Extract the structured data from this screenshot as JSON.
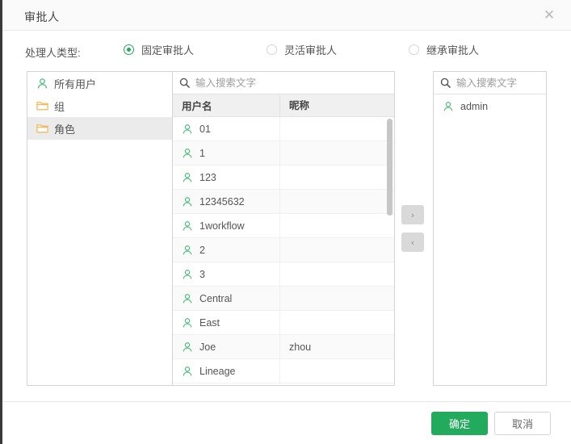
{
  "dialog": {
    "title": "审批人",
    "close_icon": "close-icon"
  },
  "handler_type": {
    "label": "处理人类型:",
    "options": [
      {
        "label": "固定审批人",
        "checked": true
      },
      {
        "label": "灵活审批人",
        "checked": false
      },
      {
        "label": "继承审批人",
        "checked": false
      }
    ]
  },
  "tree_panel": {
    "items": [
      {
        "label": "所有用户",
        "icon": "user-icon",
        "selected": false
      },
      {
        "label": "组",
        "icon": "folder-icon",
        "selected": false
      },
      {
        "label": "角色",
        "icon": "folder-icon",
        "selected": true
      }
    ]
  },
  "source_panel": {
    "search": {
      "placeholder": "输入搜索文字",
      "value": "",
      "icon": "search-icon"
    },
    "columns": [
      "用户名",
      "昵称"
    ],
    "rows": [
      {
        "username": "01",
        "nickname": ""
      },
      {
        "username": "1",
        "nickname": ""
      },
      {
        "username": "123",
        "nickname": ""
      },
      {
        "username": "12345632",
        "nickname": ""
      },
      {
        "username": "1workflow",
        "nickname": ""
      },
      {
        "username": "2",
        "nickname": ""
      },
      {
        "username": "3",
        "nickname": ""
      },
      {
        "username": "Central",
        "nickname": ""
      },
      {
        "username": "East",
        "nickname": ""
      },
      {
        "username": "Joe",
        "nickname": "zhou"
      },
      {
        "username": "Lineage",
        "nickname": ""
      }
    ]
  },
  "transfer": {
    "to_right_label": "›",
    "to_left_label": "‹"
  },
  "target_panel": {
    "search": {
      "placeholder": "输入搜索文字",
      "value": "",
      "icon": "search-icon"
    },
    "items": [
      {
        "username": "admin"
      }
    ]
  },
  "footer": {
    "confirm_label": "确定",
    "cancel_label": "取消"
  },
  "colors": {
    "accent_green": "#22ab5c",
    "folder_yellow": "#f0bb5c",
    "border": "#d4d4d4",
    "header_bg": "#f0f0f0"
  }
}
